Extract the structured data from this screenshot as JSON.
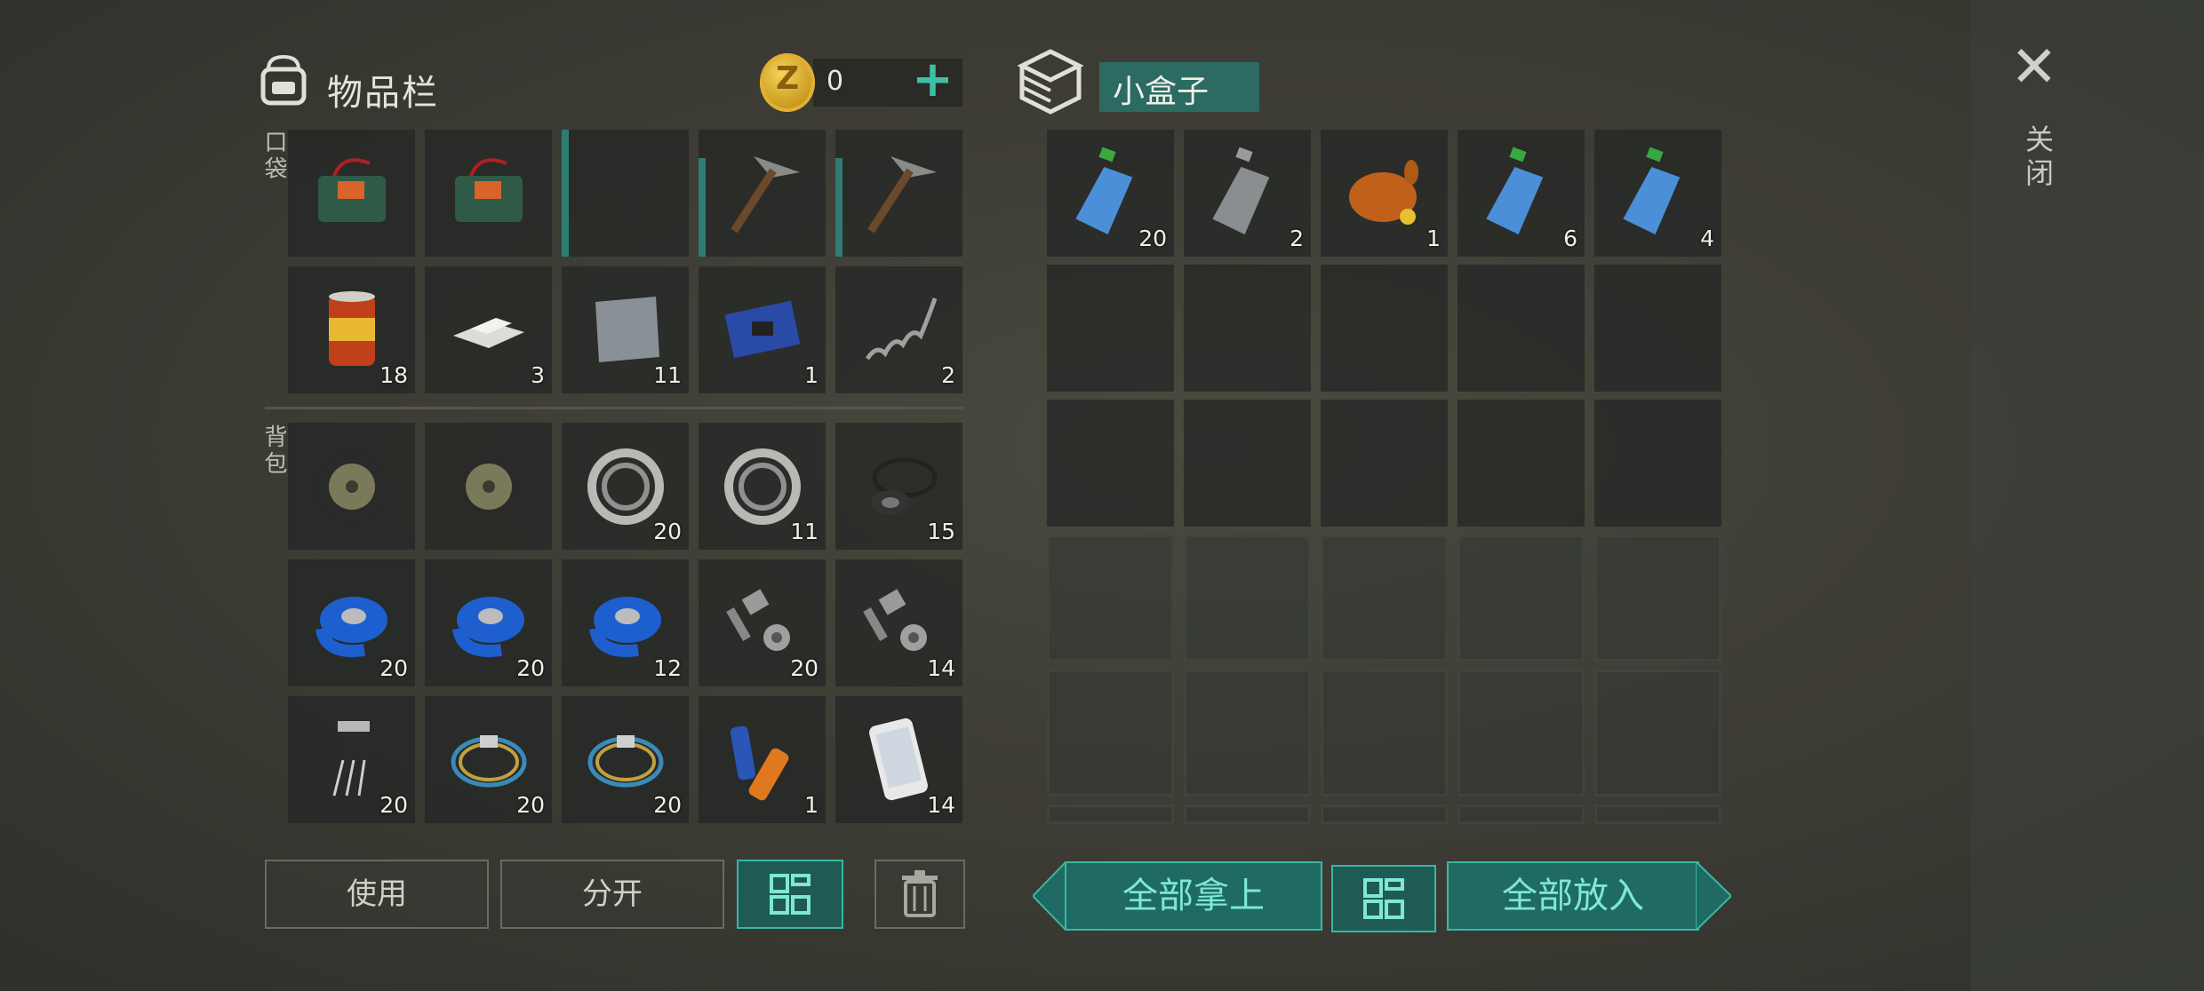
{
  "inventory": {
    "title": "物品栏",
    "coin_icon": "Z",
    "coins": "0",
    "add_icon": "plus-icon",
    "pockets_label": "口袋",
    "backpack_label": "背包",
    "pockets": [
      {
        "icon": "c4-explosive-icon",
        "count": ""
      },
      {
        "icon": "c4-explosive-icon",
        "count": ""
      },
      {
        "icon": "smg-icon",
        "count": ""
      },
      {
        "icon": "pickaxe-icon",
        "count": ""
      },
      {
        "icon": "pickaxe-icon",
        "count": ""
      },
      {
        "icon": "canned-food-icon",
        "count": "18"
      },
      {
        "icon": "aluminum-bars-icon",
        "count": "3"
      },
      {
        "icon": "steel-plate-icon",
        "count": "11"
      },
      {
        "icon": "circuit-board-icon",
        "count": "1"
      },
      {
        "icon": "spring-icon",
        "count": "2"
      }
    ],
    "backpack": [
      {
        "icon": "wheel-icon",
        "count": ""
      },
      {
        "icon": "wheel-icon",
        "count": ""
      },
      {
        "icon": "bearing-icon",
        "count": "20"
      },
      {
        "icon": "bearing-icon",
        "count": "11"
      },
      {
        "icon": "rubber-seal-icon",
        "count": "15"
      },
      {
        "icon": "duct-tape-icon",
        "count": "20"
      },
      {
        "icon": "duct-tape-icon",
        "count": "20"
      },
      {
        "icon": "duct-tape-icon",
        "count": "12"
      },
      {
        "icon": "bolt-nut-icon",
        "count": "20"
      },
      {
        "icon": "bolt-nut-icon",
        "count": "14"
      },
      {
        "icon": "transistor-icon",
        "count": "20"
      },
      {
        "icon": "wire-coil-icon",
        "count": "20"
      },
      {
        "icon": "wire-coil-icon",
        "count": "20"
      },
      {
        "icon": "batteries-icon",
        "count": "1"
      },
      {
        "icon": "smartphone-icon",
        "count": "14"
      }
    ],
    "buttons": {
      "use": "使用",
      "split": "分开",
      "sort_icon": "grid-sort-icon",
      "trash_icon": "trash-icon"
    }
  },
  "container": {
    "title": "小盒子",
    "icon": "box-icon",
    "items": [
      {
        "icon": "water-bottle-icon",
        "count": "20"
      },
      {
        "icon": "empty-bottle-icon",
        "count": "2"
      },
      {
        "icon": "roast-chicken-icon",
        "count": "1"
      },
      {
        "icon": "water-bottle-icon",
        "count": "6"
      },
      {
        "icon": "water-bottle-icon",
        "count": "4"
      }
    ],
    "take_all": "全部拿上",
    "put_all": "全部放入",
    "sort_icon": "grid-sort-icon"
  },
  "close": {
    "icon": "close-icon",
    "label": "关闭"
  },
  "colors": {
    "accent": "#34b8a4",
    "accent_dark": "#1f5a54",
    "coin": "#e1b032"
  }
}
